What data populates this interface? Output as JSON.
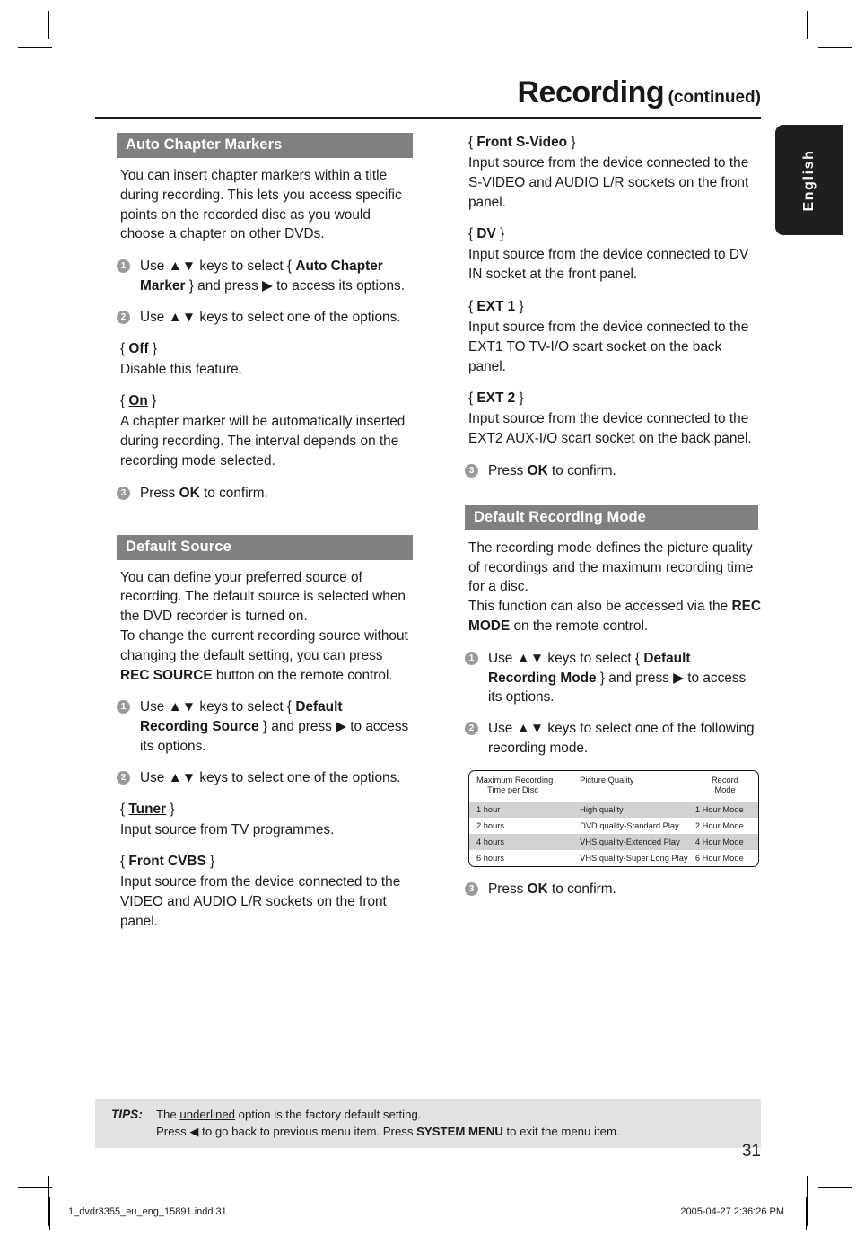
{
  "header": {
    "title_main": "Recording",
    "title_continued": "(continued)"
  },
  "language_tab": {
    "label": "English"
  },
  "left_column": {
    "section1": {
      "heading": "Auto Chapter Markers",
      "intro": "You can insert chapter markers within a title during recording. This lets you access specific points on the recorded disc as you would choose a chapter on other DVDs.",
      "steps": [
        {
          "num": "1",
          "pre": "Use ▲▼ keys to select { ",
          "bold": "Auto Chapter Marker",
          "post": " } and press ▶ to access its options."
        },
        {
          "num": "2",
          "pre": "Use ▲▼ keys to select one of the options.",
          "bold": "",
          "post": ""
        },
        {
          "num": "3",
          "pre": "Press ",
          "bold": "OK",
          "post": " to confirm."
        }
      ],
      "options": [
        {
          "name": "Off",
          "underlined": false,
          "desc": "Disable this feature."
        },
        {
          "name": "On",
          "underlined": true,
          "desc": "A chapter marker will be automatically inserted during recording. The interval depends on the recording mode selected."
        }
      ]
    },
    "section2": {
      "heading": "Default Source",
      "intro_a": "You can define your preferred source of recording. The default source is selected when the DVD recorder is turned on.",
      "intro_b_pre": "To change the current recording source without changing the default setting, you can press ",
      "intro_b_bold": "REC SOURCE",
      "intro_b_post": " button on the remote control.",
      "steps": [
        {
          "num": "1",
          "pre": "Use ▲▼ keys to select { ",
          "bold": "Default Recording Source",
          "post": " } and press ▶ to access its options."
        },
        {
          "num": "2",
          "pre": "Use ▲▼ keys to select one of the options.",
          "bold": "",
          "post": ""
        }
      ],
      "options": [
        {
          "name": "Tuner",
          "underlined": true,
          "desc": "Input source from TV programmes."
        },
        {
          "name": "Front CVBS",
          "underlined": false,
          "desc": "Input source from the device connected to the VIDEO and AUDIO L/R sockets on the front panel."
        }
      ]
    }
  },
  "right_column": {
    "source_options": [
      {
        "name": "Front S-Video",
        "desc": "Input source from the device connected to the S-VIDEO and AUDIO L/R sockets on the front panel."
      },
      {
        "name": "DV",
        "desc": "Input source from the device connected to DV IN socket at the front panel."
      },
      {
        "name": "EXT 1",
        "desc": "Input source from the device connected to the EXT1 TO TV-I/O scart socket on the back panel."
      },
      {
        "name": "EXT 2",
        "desc": "Input source from the device connected to the EXT2 AUX-I/O scart socket on the back panel."
      }
    ],
    "confirm_step": {
      "num": "3",
      "pre": "Press ",
      "bold": "OK",
      "post": " to confirm."
    },
    "section3": {
      "heading": "Default Recording Mode",
      "intro_a": "The recording mode defines the picture quality of recordings and the maximum recording time for a disc.",
      "intro_b_pre": "This function can also be accessed via the ",
      "intro_b_bold": "REC MODE",
      "intro_b_post": " on the remote control.",
      "steps": [
        {
          "num": "1",
          "pre": "Use ▲▼ keys to select { ",
          "bold": "Default Recording Mode",
          "post": " } and press ▶ to access its options."
        },
        {
          "num": "2",
          "pre": "Use ▲▼ keys to select one of the following recording mode.",
          "bold": "",
          "post": ""
        },
        {
          "num": "3",
          "pre": "Press ",
          "bold": "OK",
          "post": " to confirm."
        }
      ]
    }
  },
  "rec_mode_table": {
    "headers": {
      "col1_line1": "Maximum Recording",
      "col1_line2": "Time per Disc",
      "col2": "Picture Quality",
      "col3_line1": "Record",
      "col3_line2": "Mode"
    },
    "rows": [
      {
        "time": "1 hour",
        "quality": "High quality",
        "mode": "1 Hour Mode",
        "shaded": true
      },
      {
        "time": "2 hours",
        "quality": "DVD quality-Standard Play",
        "mode": "2 Hour Mode",
        "shaded": false
      },
      {
        "time": "4 hours",
        "quality": "VHS quality-Extended Play",
        "mode": "4 Hour Mode",
        "shaded": true
      },
      {
        "time": "6 hours",
        "quality": "VHS quality-Super Long Play",
        "mode": "6 Hour Mode",
        "shaded": false
      }
    ]
  },
  "tips": {
    "label": "TIPS:",
    "line1_pre": "The ",
    "line1_underline": "underlined",
    "line1_post": " option is the factory default setting.",
    "line2_pre": "Press ◀ to go back to previous menu item. Press ",
    "line2_bold": "SYSTEM MENU",
    "line2_post": " to exit the menu item."
  },
  "page_number": "31",
  "print_footer": {
    "file": "1_dvdr3355_eu_eng_15891.indd   31",
    "date": "2005-04-27   2:36:26 PM"
  },
  "colors": {
    "section_bar": "#808080",
    "tips_bg": "#e2e2e2",
    "bullet": "#9a9a9a",
    "table_shade": "#d2d2d2",
    "tab_bg": "#1f1f21"
  }
}
